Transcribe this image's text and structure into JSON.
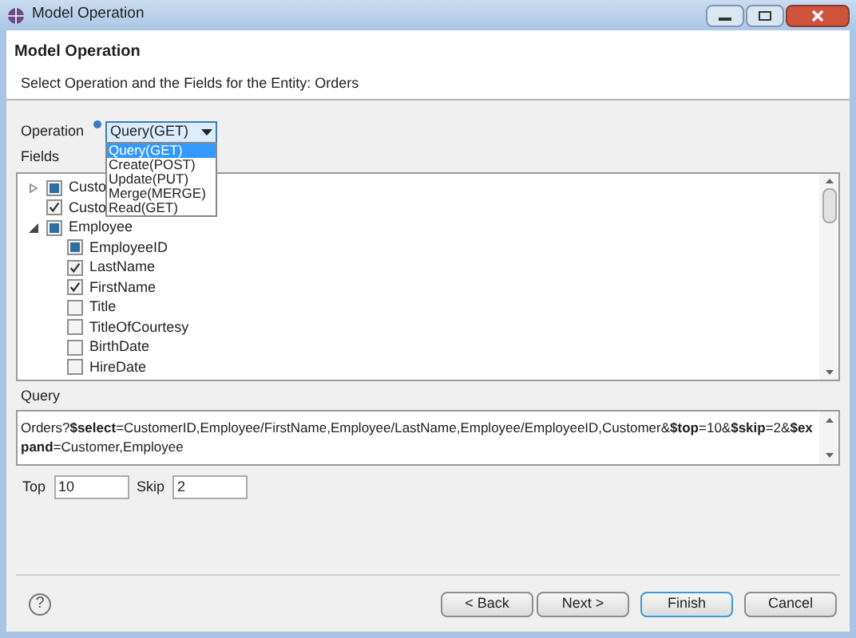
{
  "window": {
    "title": "Model Operation"
  },
  "header": {
    "title": "Model Operation",
    "description": "Select Operation and the Fields for the Entity: Orders"
  },
  "operation": {
    "label": "Operation",
    "value": "Query(GET)",
    "expanded": true,
    "options": [
      {
        "label": "Query(GET)",
        "selected": true
      },
      {
        "label": "Create(POST)",
        "selected": false
      },
      {
        "label": "Update(PUT)",
        "selected": false
      },
      {
        "label": "Merge(MERGE)",
        "selected": false
      },
      {
        "label": "Read(GET)",
        "selected": false
      }
    ]
  },
  "fields": {
    "label": "Fields",
    "tree": [
      {
        "label": "Custo",
        "checked": false,
        "partial": true,
        "expanded": false
      },
      {
        "label": "Custo",
        "checked": true
      },
      {
        "label": "Employee",
        "checked": false,
        "partial": true,
        "expanded": true,
        "children": [
          {
            "label": "EmployeeID",
            "checked": false,
            "partial": true
          },
          {
            "label": "LastName",
            "checked": true
          },
          {
            "label": "FirstName",
            "checked": true
          },
          {
            "label": "Title",
            "checked": false
          },
          {
            "label": "TitleOfCourtesy",
            "checked": false
          },
          {
            "label": "BirthDate",
            "checked": false
          },
          {
            "label": "HireDate",
            "checked": false
          }
        ]
      }
    ]
  },
  "query": {
    "label": "Query",
    "value": "Orders?**$select**=CustomerID,Employee/FirstName,Employee/LastName,Employee/EmployeeID,Customer&**$top**=10&**$skip**=2&**$expand**=Customer,Employee"
  },
  "top": {
    "label": "Top",
    "value": "10"
  },
  "skip": {
    "label": "Skip",
    "value": "2"
  },
  "help": "?",
  "buttons": [
    {
      "label": "< Back",
      "default": false
    },
    {
      "label": "Next >",
      "default": false
    },
    {
      "label": "Finish",
      "default": true
    },
    {
      "label": "Cancel",
      "default": false
    }
  ]
}
